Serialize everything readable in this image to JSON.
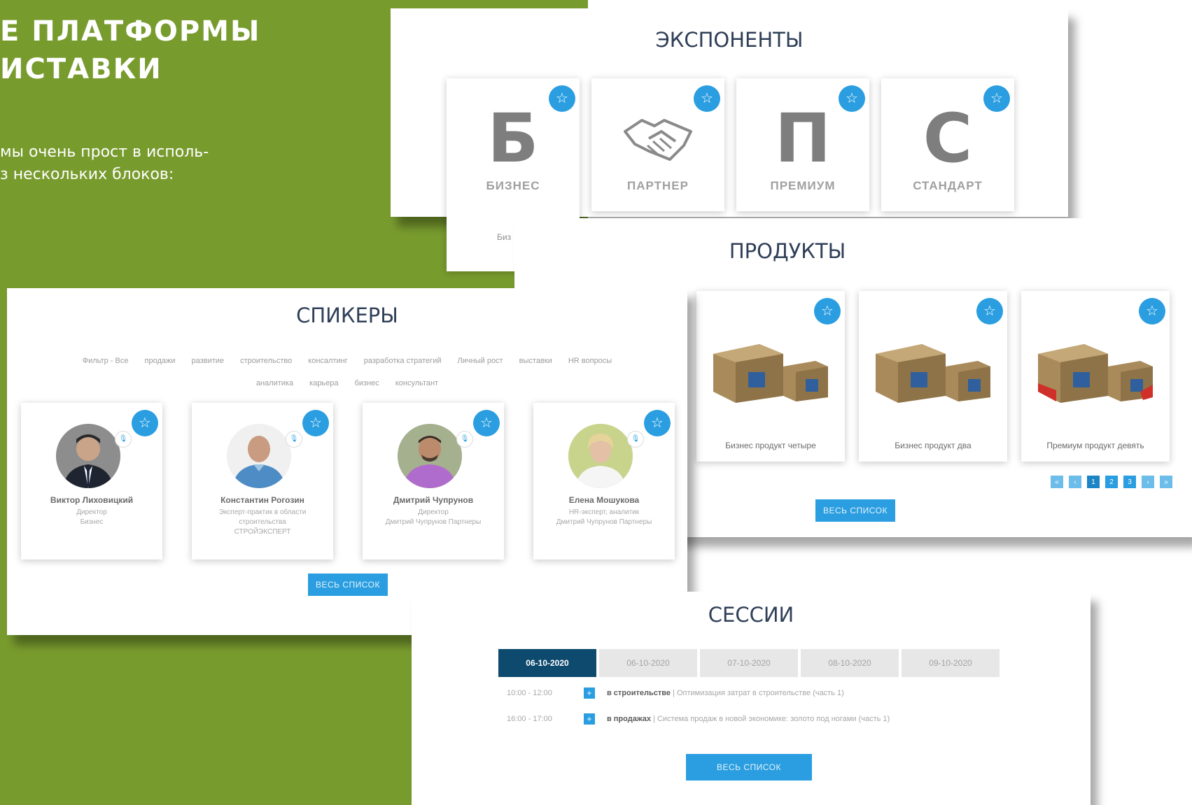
{
  "intro": {
    "title": "Е ПЛАТФОРМЫ\nИСТАВКИ",
    "text": "мы очень прост в исполь-\nз нескольких блоков:"
  },
  "exponents": {
    "title": "ЭКСПОНЕНТЫ",
    "cards": [
      {
        "letter": "Б",
        "label": "БИЗНЕС",
        "extra": "Биз"
      },
      {
        "letter": "",
        "label": "ПАРТНЕР",
        "icon": "handshake-icon"
      },
      {
        "letter": "П",
        "label": "ПРЕМИУМ"
      },
      {
        "letter": "С",
        "label": "СТАНДАРТ"
      }
    ]
  },
  "products": {
    "title": "ПРОДУКТЫ",
    "cards": [
      {
        "name": "Бизнес продукт четыре"
      },
      {
        "name": "Бизнес продукт два"
      },
      {
        "name": "Премиум продукт девять"
      }
    ],
    "pager": [
      "«",
      "‹",
      "1",
      "2",
      "3",
      "›",
      "»"
    ],
    "button": "ВЕСЬ СПИСОК"
  },
  "speakers": {
    "title": "СПИКЕРЫ",
    "tags_row1": [
      "Фильтр - Все",
      "продажи",
      "развитие",
      "строительство",
      "консалтинг",
      "разработка стратегий",
      "Личный рост",
      "выставки",
      "HR вопросы"
    ],
    "tags_row2": [
      "аналитика",
      "карьера",
      "бизнес",
      "консультант"
    ],
    "cards": [
      {
        "name": "Виктор Лиховицкий",
        "info": "Директор\nБизнес"
      },
      {
        "name": "Константин Рогозин",
        "info": "Эксперт-практик в области\nстроительства\nСТРОЙЭКСПЕРТ"
      },
      {
        "name": "Дмитрий Чупрунов",
        "info": "Директор\nДмитрий Чупрунов Партнеры"
      },
      {
        "name": "Елена Мошукова",
        "info": "HR-эксперт, аналитик\nДмитрий Чупрунов Партнеры"
      }
    ],
    "button": "ВЕСЬ СПИСОК"
  },
  "sessions": {
    "title": "СЕССИИ",
    "dates": [
      "06-10-2020",
      "06-10-2020",
      "07-10-2020",
      "08-10-2020",
      "09-10-2020"
    ],
    "active_date_index": 0,
    "rows": [
      {
        "time": "10:00 - 12:00",
        "topic": "в строительстве",
        "desc": "Оптимизация затрат в строительстве (часть 1)"
      },
      {
        "time": "16:00 - 17:00",
        "topic": "в продажах",
        "desc": "Система продаж в новой экономике: золото под ногами (часть 1)"
      }
    ],
    "button": "ВЕСЬ СПИСОК"
  },
  "colors": {
    "green": "#789b2e",
    "accent": "#2a9ee0",
    "active_tab": "#0d4a6e",
    "title": "#2f3f58"
  }
}
